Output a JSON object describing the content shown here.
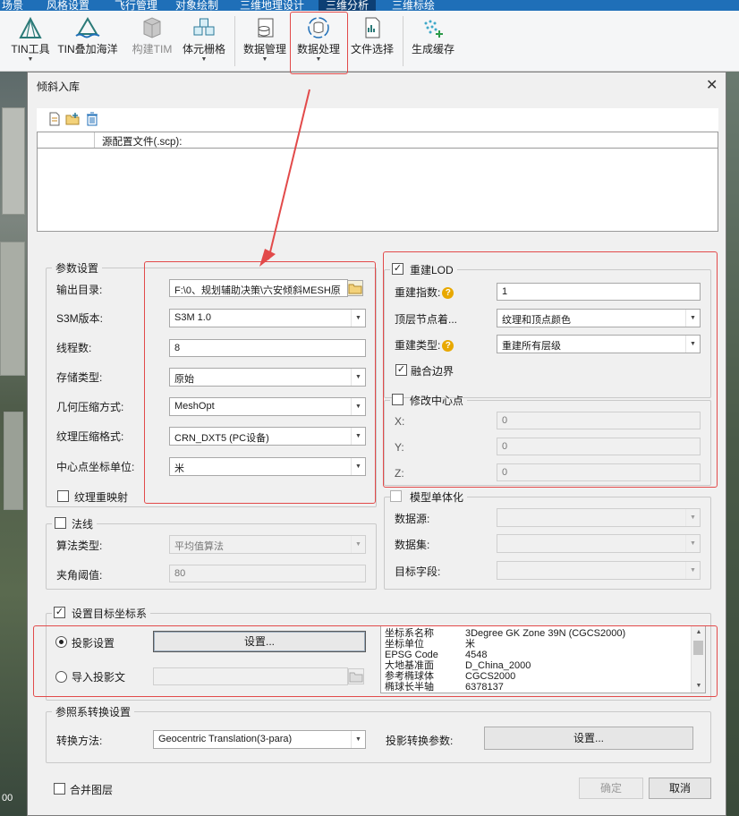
{
  "menubar": {
    "tabs": [
      "场景",
      "风格设置",
      "飞行管理",
      "对象绘制",
      "三维地理设计",
      "三维分析",
      "三维标绘"
    ],
    "active_index": 5
  },
  "ribbon": {
    "buttons": [
      {
        "label": "TIN工具",
        "has_dropdown": true,
        "enabled": true,
        "icon": "tin-tool-icon"
      },
      {
        "label": "TIN叠加海洋",
        "has_dropdown": false,
        "enabled": true,
        "icon": "tin-ocean-icon"
      },
      {
        "label": "构建TIM",
        "has_dropdown": false,
        "enabled": false,
        "icon": "build-tim-icon"
      },
      {
        "label": "体元栅格",
        "has_dropdown": true,
        "enabled": true,
        "icon": "voxel-grid-icon"
      },
      {
        "label": "数据管理",
        "has_dropdown": true,
        "enabled": true,
        "icon": "data-manage-icon"
      },
      {
        "label": "数据处理",
        "has_dropdown": true,
        "enabled": true,
        "icon": "data-process-icon"
      },
      {
        "label": "文件选择",
        "has_dropdown": false,
        "enabled": true,
        "icon": "file-select-icon"
      },
      {
        "label": "生成缓存",
        "has_dropdown": false,
        "enabled": true,
        "icon": "generate-cache-icon"
      }
    ]
  },
  "dialog": {
    "title": "倾斜入库",
    "close": "✕",
    "file_list": {
      "column_header": "源配置文件(.scp):"
    },
    "params": {
      "legend": "参数设置",
      "output_dir_label": "输出目录:",
      "output_dir_value": "F:\\0、规划辅助决策\\六安倾斜MESH原",
      "s3m_version_label": "S3M版本:",
      "s3m_version_value": "S3M 1.0",
      "threads_label": "线程数:",
      "threads_value": "8",
      "storage_type_label": "存储类型:",
      "storage_type_value": "原始",
      "geometry_compress_label": "几何压缩方式:",
      "geometry_compress_value": "MeshOpt",
      "texture_compress_label": "纹理压缩格式:",
      "texture_compress_value": "CRN_DXT5 (PC设备)",
      "center_unit_label": "中心点坐标单位:",
      "center_unit_value": "米",
      "texture_remap_label": "纹理重映射",
      "texture_remap_checked": false
    },
    "normal": {
      "legend": "法线",
      "checked": false,
      "algorithm_label": "算法类型:",
      "algorithm_value": "平均值算法",
      "angle_label": "夹角阈值:",
      "angle_value": "80"
    },
    "lod": {
      "legend": "重建LOD",
      "checked": true,
      "rebuild_index_label": "重建指数:",
      "rebuild_index_value": "1",
      "top_node_label": "顶层节点着...",
      "top_node_value": "纹理和顶点颜色",
      "rebuild_type_label": "重建类型:",
      "rebuild_type_value": "重建所有层级",
      "merge_border_label": "融合边界",
      "merge_border_checked": true
    },
    "center": {
      "legend": "修改中心点",
      "checked": false,
      "x_label": "X:",
      "x_value": "0",
      "y_label": "Y:",
      "y_value": "0",
      "z_label": "Z:",
      "z_value": "0"
    },
    "singleton": {
      "legend": "模型单体化",
      "checked": false,
      "datasource_label": "数据源:",
      "dataset_label": "数据集:",
      "target_field_label": "目标字段:"
    },
    "target_crs": {
      "legend": "设置目标坐标系",
      "checked": true,
      "projection_setting_label": "投影设置",
      "projection_setting_selected": true,
      "setting_button": "设置...",
      "import_projection_label": "导入投影文",
      "info_rows": [
        {
          "k": "坐标系名称",
          "v": "3Degree GK Zone 39N    (CGCS2000)"
        },
        {
          "k": "坐标单位",
          "v": "米"
        },
        {
          "k": "EPSG Code",
          "v": "4548"
        },
        {
          "k": "大地基准面",
          "v": "D_China_2000"
        },
        {
          "k": "参考椭球体",
          "v": "CGCS2000"
        },
        {
          "k": "椭球长半轴",
          "v": "6378137"
        }
      ]
    },
    "ref_transform": {
      "legend": "参照系转换设置",
      "method_label": "转换方法:",
      "method_value": "Geocentric Translation(3-para)",
      "proj_param_label": "投影转换参数:",
      "setting_button": "设置..."
    },
    "merge_layers_label": "合并图层",
    "merge_layers_checked": false,
    "ok_button": "确定",
    "cancel_button": "取消"
  },
  "map_labels": {
    "scale_text": "00"
  },
  "colors": {
    "annotation_red": "#e24a4a",
    "menubar_blue": "#1f6fb8"
  }
}
